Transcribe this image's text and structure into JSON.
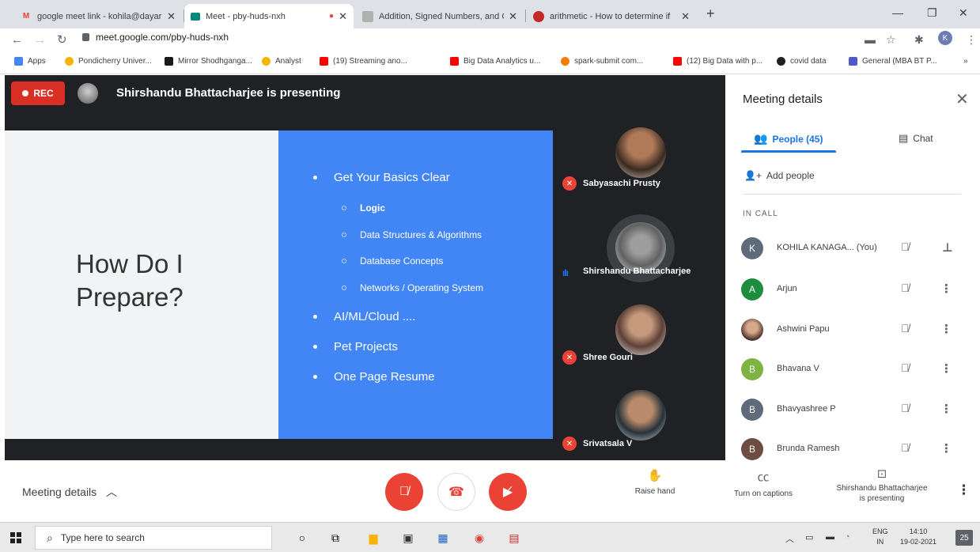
{
  "browser": {
    "tabs": [
      {
        "title": "google meet link - kohila@dayar",
        "icon": "gmail-icon",
        "active": false
      },
      {
        "title": "Meet - pby-huds-nxh",
        "icon": "meet-icon",
        "active": true
      },
      {
        "title": "Addition, Signed Numbers, and C",
        "icon": "doc-icon",
        "active": false
      },
      {
        "title": "arithmetic - How to determine if",
        "icon": "stackexchange-icon",
        "active": false
      }
    ],
    "url": "meet.google.com/pby-huds-nxh",
    "bookmarks": [
      {
        "label": "Apps",
        "color": "#4285f4"
      },
      {
        "label": "Pondicherry Univer...",
        "color": "#f4b400"
      },
      {
        "label": "Mirror Shodhganga...",
        "color": "#1a1a1a"
      },
      {
        "label": "Analyst",
        "color": "#f4b400"
      },
      {
        "label": "(19) Streaming ano...",
        "color": "#ff0000"
      },
      {
        "label": "Big Data Analytics u...",
        "color": "#ff0000"
      },
      {
        "label": "spark-submit com...",
        "color": "#f57c00"
      },
      {
        "label": "(12) Big Data with p...",
        "color": "#ff0000"
      },
      {
        "label": "covid data",
        "color": "#202124"
      },
      {
        "label": "General (MBA BT P...",
        "color": "#5059c9"
      }
    ],
    "profile_initial": "K",
    "more_bookmarks": "»"
  },
  "meet": {
    "rec_label": "REC",
    "presenting_banner": "Shirshandu Bhattacharjee is presenting",
    "slide": {
      "title_line1": "How Do I",
      "title_line2": "Prepare?",
      "bullets": [
        "Get Your Basics Clear",
        "AI/ML/Cloud ....",
        "Pet Projects",
        "One Page Resume"
      ],
      "sub_bullets": [
        "Logic",
        "Data Structures & Algorithms",
        "Database Concepts",
        "Networks / Operating System"
      ]
    },
    "tiles": [
      {
        "name": "Sabyasachi Prusty",
        "muted": true
      },
      {
        "name": "Shirshandu Bhattacharjee",
        "muted": false
      },
      {
        "name": "Shree Gouri",
        "muted": true
      },
      {
        "name": "Srivatsala V",
        "muted": true
      }
    ]
  },
  "panel": {
    "title": "Meeting details",
    "people_tab": "People (45)",
    "chat_tab": "Chat",
    "add_people": "Add people",
    "in_call": "IN CALL",
    "people": [
      {
        "initial": "K",
        "name": "KOHILA KANAGA...  (You)",
        "color": "#5f6b7a"
      },
      {
        "initial": "A",
        "name": "Arjun",
        "color": "#1e8e3e"
      },
      {
        "initial": "",
        "name": "Ashwini Papu",
        "color": "#8d6e63"
      },
      {
        "initial": "B",
        "name": "Bhavana V",
        "color": "#7cb342"
      },
      {
        "initial": "B",
        "name": "Bhavyashree P",
        "color": "#5f6b7a"
      },
      {
        "initial": "B",
        "name": "Brunda Ramesh",
        "color": "#6d4c41"
      }
    ]
  },
  "controls": {
    "meeting_details": "Meeting details",
    "raise_hand": "Raise hand",
    "captions": "Turn on captions",
    "presenting_line1": "Shirshandu Bhattacharjee",
    "presenting_line2": "is presenting"
  },
  "taskbar": {
    "search_placeholder": "Type here to search",
    "lang_line1": "ENG",
    "lang_line2": "IN",
    "time": "14:10",
    "date": "19-02-2021",
    "notification_count": "25"
  }
}
